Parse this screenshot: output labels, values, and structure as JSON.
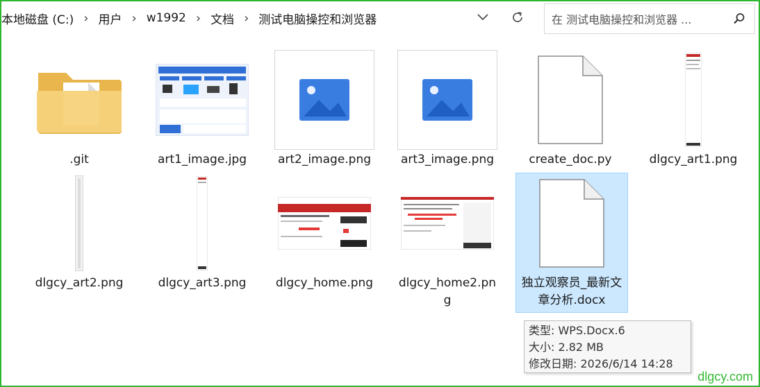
{
  "breadcrumb": [
    "本地磁盘 (C:)",
    "用户",
    "w1992",
    "文档",
    "测试电脑操控和浏览器"
  ],
  "search": {
    "placeholder": "在 测试电脑操控和浏览器 ..."
  },
  "files": [
    {
      "name": ".git",
      "type": "folder"
    },
    {
      "name": "art1_image.jpg",
      "type": "image-infographic"
    },
    {
      "name": "art2_image.png",
      "type": "image-placeholder"
    },
    {
      "name": "art3_image.png",
      "type": "image-placeholder"
    },
    {
      "name": "create_doc.py",
      "type": "document"
    },
    {
      "name": "dlgcy_art1.png",
      "type": "image-tall"
    },
    {
      "name": "dlgcy_art2.png",
      "type": "image-tall"
    },
    {
      "name": "dlgcy_art3.png",
      "type": "image-tall"
    },
    {
      "name": "dlgcy_home.png",
      "type": "image-webpage"
    },
    {
      "name": "dlgcy_home2.png",
      "type": "image-webpage"
    },
    {
      "name": "独立观察员_最新文章分析.docx",
      "type": "document",
      "selected": true
    }
  ],
  "tooltip": {
    "type": "类型: WPS.Docx.6",
    "size": "大小: 2.82 MB",
    "modified": "修改日期: 2026/6/14 14:28"
  },
  "watermark": "dlgcy.com",
  "colors": {
    "frame": "#2fb52f",
    "selection": "#cce8ff",
    "accent": "#3a7de0",
    "watermark": "#34b934"
  }
}
